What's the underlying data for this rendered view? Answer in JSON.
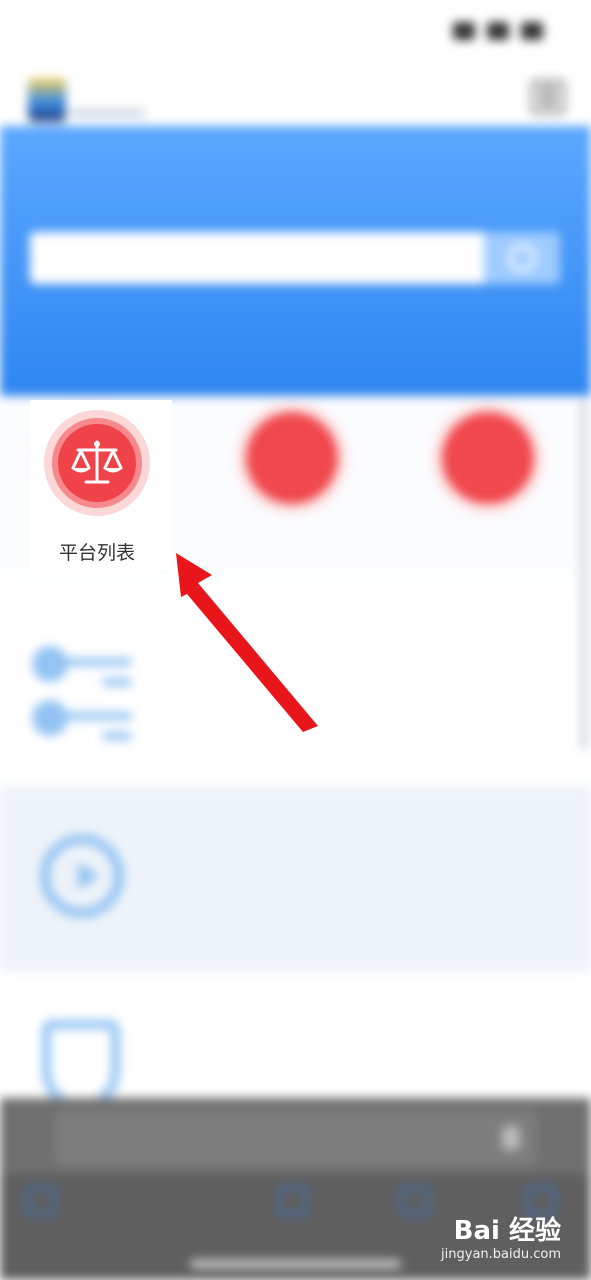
{
  "quick_entries": [
    {
      "label": "平台列表"
    }
  ],
  "watermark": {
    "brand": "Bai 经验",
    "url": "jingyan.baidu.com"
  },
  "colors": {
    "banner": "#2f86f0",
    "entry_red": "#f04249",
    "arrow": "#e8161b",
    "feature_icon": "#93c3f3"
  },
  "icons": {
    "balance_scale": "balance-scale-icon",
    "pointer_arrow": "red-arrow-annotation"
  }
}
